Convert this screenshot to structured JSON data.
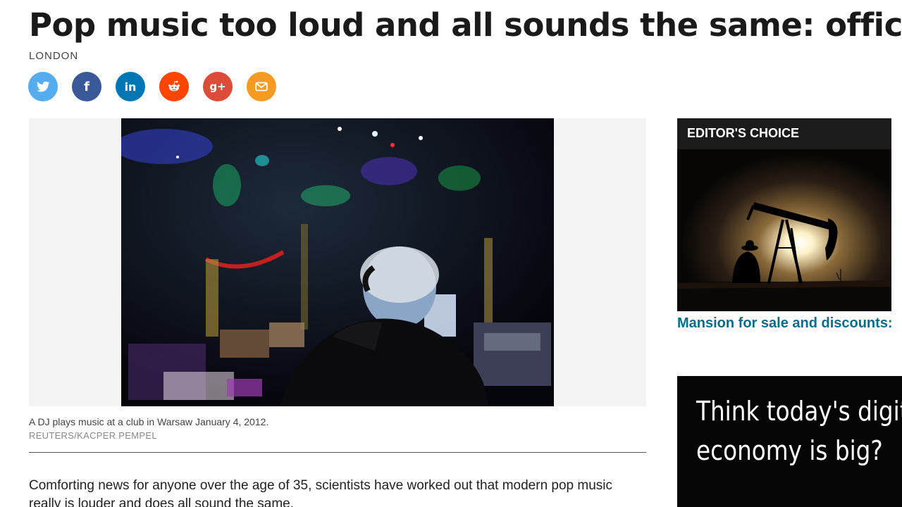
{
  "article": {
    "headline": "Pop music too loud and all sounds the same: official",
    "dateline": "LONDON",
    "share": [
      {
        "name": "twitter",
        "color": "#55acee"
      },
      {
        "name": "facebook",
        "color": "#3b5998"
      },
      {
        "name": "linkedin",
        "color": "#0077b5"
      },
      {
        "name": "reddit",
        "color": "#ff4500"
      },
      {
        "name": "google-plus",
        "color": "#dd4b39"
      },
      {
        "name": "email",
        "color": "#f59a23"
      }
    ],
    "photo": {
      "caption": "A DJ plays music at a club in Warsaw January 4, 2012.",
      "credit": "REUTERS/KACPER PEMPEL"
    },
    "body": "Comforting news for anyone over the age of 35, scientists have worked out that modern pop music really is louder and does all sound the same."
  },
  "sidebar": {
    "editors_choice": {
      "header": "EDITOR'S CHOICE",
      "headline": "Mansion for sale and discounts: oil rout hits Houston's rich"
    },
    "ad": {
      "line1": "Think today's digital",
      "line2": "economy is big?"
    }
  },
  "colors": {
    "headline_link": "#0b6b8a",
    "header_bg": "#1b1b1b"
  }
}
